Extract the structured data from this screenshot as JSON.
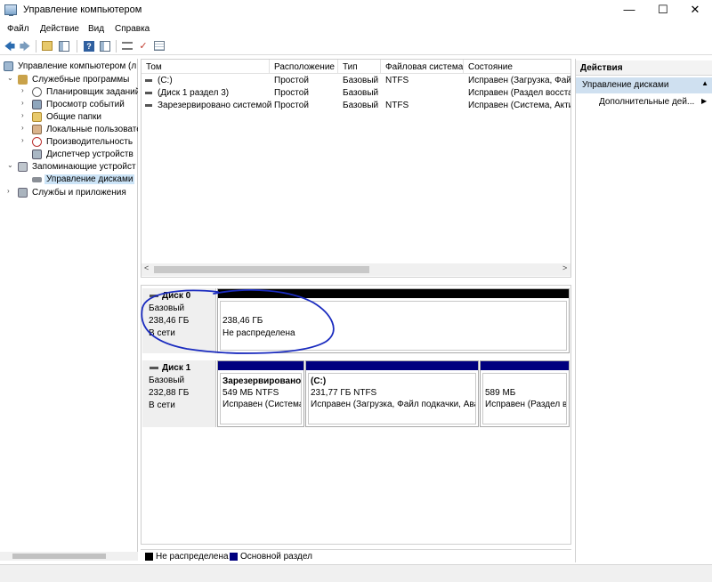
{
  "window": {
    "title": "Управление компьютером",
    "minimize": "—",
    "maximize": "☐",
    "close": "✕"
  },
  "menu": [
    "Файл",
    "Действие",
    "Вид",
    "Справка"
  ],
  "toolbar": {
    "back": "🡄",
    "forward": "🡆",
    "help": "?",
    "check": "✓"
  },
  "tree": {
    "root": "Управление компьютером (л",
    "system_tools": "Служебные программы",
    "task_scheduler": "Планировщик заданий",
    "event_viewer": "Просмотр событий",
    "shared_folders": "Общие папки",
    "local_users": "Локальные пользовате",
    "performance": "Производительность",
    "device_manager": "Диспетчер устройств",
    "storage": "Запоминающие устройст",
    "disk_management": "Управление дисками",
    "services": "Службы и приложения",
    "expanded_glyph": "⌄",
    "collapsed_glyph": "›"
  },
  "volume_list": {
    "columns": [
      "Том",
      "Расположение",
      "Тип",
      "Файловая система",
      "Состояние"
    ],
    "rows": [
      [
        "(C:)",
        "Простой",
        "Базовый",
        "NTFS",
        "Исправен (Загрузка, Файл"
      ],
      [
        "(Диск 1 раздел 3)",
        "Простой",
        "Базовый",
        "",
        "Исправен (Раздел восстан"
      ],
      [
        "Зарезервировано системой",
        "Простой",
        "Базовый",
        "NTFS",
        "Исправен (Система, Актив"
      ]
    ],
    "scroll_left": "<",
    "scroll_right": ">"
  },
  "disks": {
    "disk0": {
      "name": "Диск 0",
      "type": "Базовый",
      "size": "238,46 ГБ",
      "status": "В сети",
      "partition": {
        "size": "238,46 ГБ",
        "state": "Не распределена"
      }
    },
    "disk1": {
      "name": "Диск 1",
      "type": "Базовый",
      "size": "232,88 ГБ",
      "status": "В сети",
      "partitions": [
        {
          "title": "Зарезервировано",
          "size": "549 МБ NTFS",
          "state": "Исправен (Система"
        },
        {
          "title": "(C:)",
          "size": "231,77 ГБ NTFS",
          "state": "Исправен (Загрузка, Файл подкачки, Ава"
        },
        {
          "title": "",
          "size": "589 МБ",
          "state": "Исправен (Раздел в"
        }
      ]
    }
  },
  "legend": {
    "unallocated": "Не распределена",
    "primary": "Основной раздел",
    "unallocated_color": "#000000",
    "primary_color": "#00007f"
  },
  "actions": {
    "header": "Действия",
    "section": "Управление дисками",
    "more": "Дополнительные дей...",
    "more_arrow": "▶",
    "collapse_arrow": "▲"
  },
  "colors": {
    "selection": "#cce4f7",
    "annotation": "#1a2bbf"
  }
}
